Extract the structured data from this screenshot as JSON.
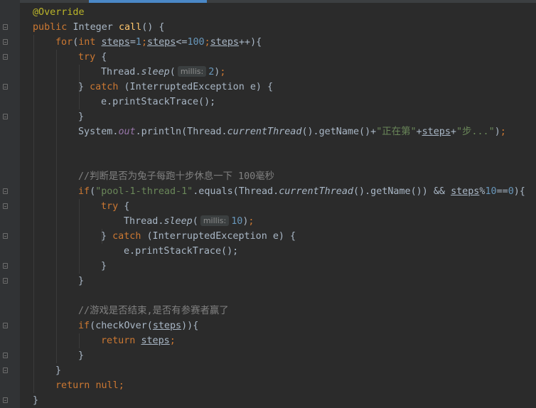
{
  "editor": {
    "tokens": {
      "annotation": "@Override",
      "kw_public": "public",
      "type_integer": "Integer",
      "method_call": "call",
      "kw_for": "for",
      "kw_int": "int",
      "var_steps": "steps",
      "num_1": "1",
      "num_100": "100",
      "kw_try": "try",
      "thread": "Thread.",
      "sleep": "sleep",
      "hint_millis": "millis:",
      "num_2": "2",
      "kw_catch": "catch",
      "exception": "(InterruptedException e) {",
      "print_stack": "e.printStackTrace();",
      "system": "System.",
      "out": "out",
      "println": ".println(Thread.",
      "current_thread": "currentThread",
      "get_name": "().getName()+",
      "str_zhengzai": "\"正在第\"",
      "str_bu": "\"步...\"",
      "comment_1": "//判断是否为兔子每跑十步休息一下 100毫秒",
      "kw_if": "if",
      "str_pool": "\"pool-1-thread-1\"",
      "equals": ".equals(Thread.",
      "get_name_close": "().getName()) && ",
      "num_10": "10",
      "num_0": "0",
      "comment_2": "//游戏是否结束,是否有参赛者赢了",
      "check_over": "checkOver",
      "kw_return": "return",
      "kw_null": "null"
    }
  }
}
